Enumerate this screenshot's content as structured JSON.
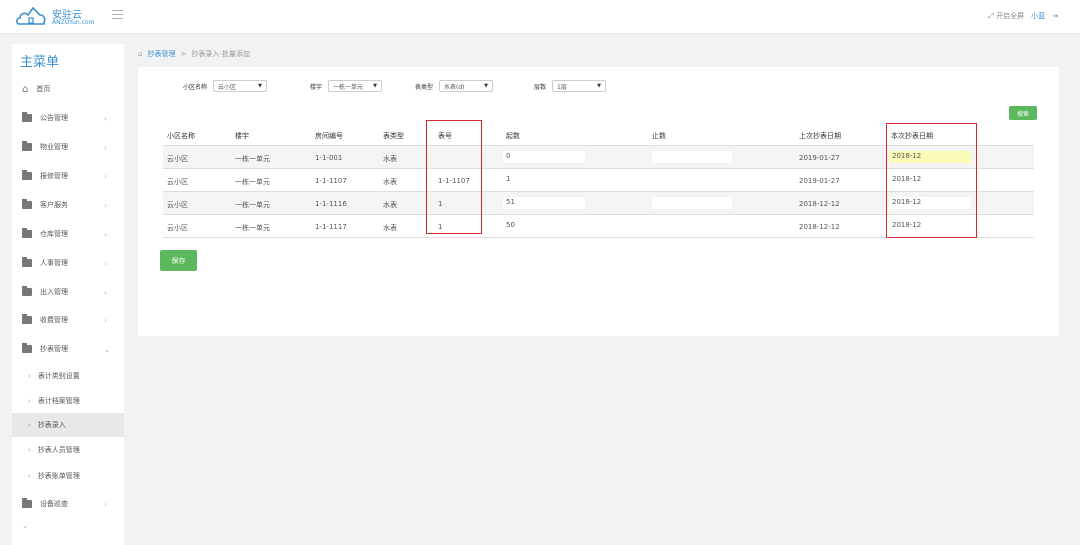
{
  "app": {
    "logo_cn": "安驻云",
    "logo_en": "ANZOYun.com",
    "fullscreen_label": "开启全屏",
    "user_name": "小蓝"
  },
  "sidebar": {
    "title": "主菜单",
    "items": [
      {
        "label": "首页",
        "icon": "home-icon"
      },
      {
        "label": "公告管理",
        "icon": "folder-icon"
      },
      {
        "label": "物业管理",
        "icon": "folder-icon"
      },
      {
        "label": "报修管理",
        "icon": "folder-icon"
      },
      {
        "label": "客户服务",
        "icon": "folder-icon"
      },
      {
        "label": "仓库管理",
        "icon": "folder-icon"
      },
      {
        "label": "人事管理",
        "icon": "folder-icon"
      },
      {
        "label": "出入管理",
        "icon": "folder-icon"
      },
      {
        "label": "收费管理",
        "icon": "folder-icon"
      },
      {
        "label": "抄表管理",
        "icon": "folder-icon"
      }
    ],
    "sub_items": [
      {
        "label": "表计类别设置"
      },
      {
        "label": "表计档案管理"
      },
      {
        "label": "抄表录入",
        "active": true
      },
      {
        "label": "抄表人员管理"
      },
      {
        "label": "抄表账单管理"
      }
    ],
    "last_item": {
      "label": "设备巡查",
      "icon": "folder-icon"
    }
  },
  "breadcrumb": {
    "parent": "抄表管理",
    "current": "抄表录入-批量添加"
  },
  "filters": {
    "community": {
      "label": "小区名称",
      "value": "云小区"
    },
    "building": {
      "label": "楼宇",
      "value": "一栋一单元"
    },
    "meter_type": {
      "label": "表类型",
      "value": "水表(d)"
    },
    "floor": {
      "label": "层数",
      "value": "1层"
    }
  },
  "search_label": "搜索",
  "table": {
    "headers": [
      "小区名称",
      "楼宇",
      "房间编号",
      "表类型",
      "表号",
      "起数",
      "止数",
      "上次抄表日期",
      "本次抄表日期"
    ],
    "rows": [
      {
        "community": "云小区",
        "building": "一栋一单元",
        "room": "1-1-001",
        "type": "水表",
        "meter_no": "",
        "start": "0",
        "end": "",
        "last_date": "2019-01-27",
        "this_date": "2018-12"
      },
      {
        "community": "云小区",
        "building": "一栋一单元",
        "room": "1-1-1107",
        "type": "水表",
        "meter_no": "1-1-1107",
        "start": "1",
        "end": "",
        "last_date": "2019-01-27",
        "this_date": "2018-12"
      },
      {
        "community": "云小区",
        "building": "一栋一单元",
        "room": "1-1-1116",
        "type": "水表",
        "meter_no": "1",
        "start": "51",
        "end": "",
        "last_date": "2018-12-12",
        "this_date": "2018-12"
      },
      {
        "community": "云小区",
        "building": "一栋一单元",
        "room": "1-1-1117",
        "type": "水表",
        "meter_no": "1",
        "start": "50",
        "end": "",
        "last_date": "2018-12-12",
        "this_date": "2018-12"
      }
    ]
  },
  "save_label": "保存",
  "colors": {
    "accent": "#3b8fd1",
    "button_green": "#5cb85c",
    "highlight_red": "#d9272d",
    "input_highlight": "#fbfbb8"
  }
}
